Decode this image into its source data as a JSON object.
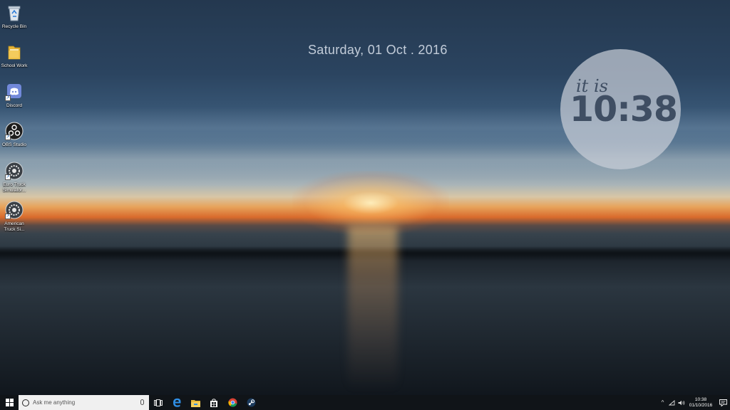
{
  "desktop": {
    "icons": [
      {
        "label": "Recycle Bin",
        "icon": "recycle-bin-icon"
      },
      {
        "label": "School Work",
        "icon": "folder-icon"
      },
      {
        "label": "Discord",
        "icon": "discord-icon"
      },
      {
        "label": "OBS Studio",
        "icon": "obs-icon"
      },
      {
        "label": "Euro Truck Simulator...",
        "icon": "euro-truck-icon"
      },
      {
        "label": "American Truck Si...",
        "icon": "american-truck-icon"
      }
    ]
  },
  "widget": {
    "date": "Saturday, 01 Oct . 2016",
    "it_is": "it is",
    "time": "10:38"
  },
  "taskbar": {
    "search_placeholder": "Ask me anything",
    "pinned": [
      "task-view-icon",
      "edge-icon",
      "file-explorer-icon",
      "store-icon",
      "chrome-icon",
      "steam-icon"
    ],
    "tray": {
      "time": "10:38",
      "date": "01/10/2016"
    }
  },
  "colors": {
    "taskbar": "#101418",
    "clock_text": "#3f4e63",
    "accent_blue": "#1e88e5"
  }
}
